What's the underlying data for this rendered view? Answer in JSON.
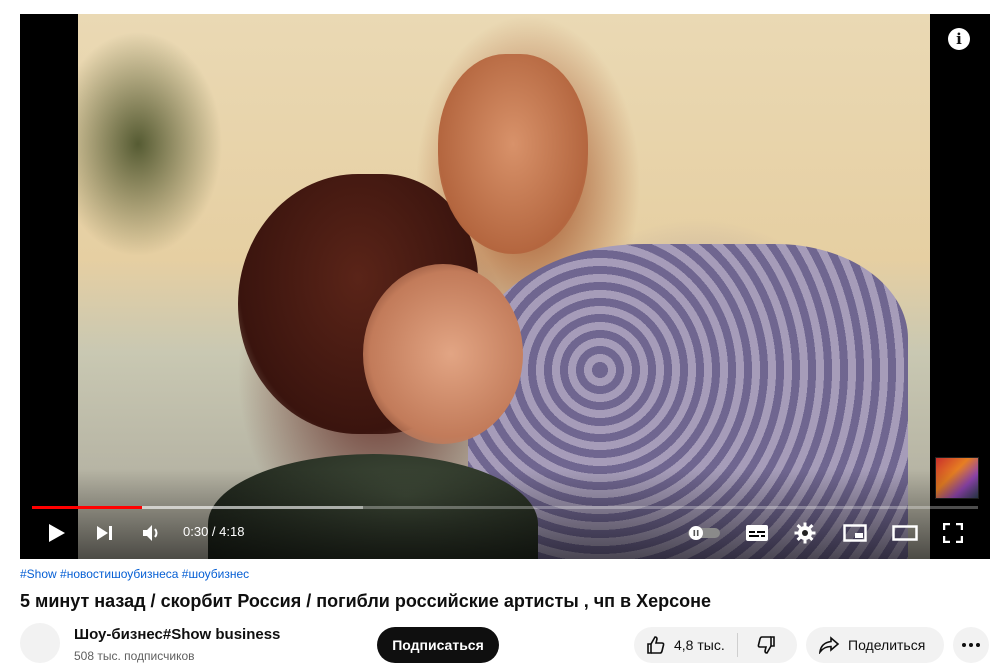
{
  "player": {
    "current_time": "0:30",
    "duration": "4:18",
    "time_display": "0:30 / 4:18",
    "progress_played": 0.116,
    "progress_buffered": 0.35,
    "icons": {
      "info": "info-icon",
      "play": "play-icon",
      "next": "next-icon",
      "volume": "volume-icon",
      "autoplay": "autoplay-toggle-icon",
      "subtitles": "subtitles-icon",
      "settings": "gear-icon",
      "miniplayer": "miniplayer-icon",
      "theater": "theater-mode-icon",
      "fullscreen": "fullscreen-icon"
    },
    "colors": {
      "progress": "#ff0000",
      "background": "#000000"
    }
  },
  "video": {
    "hashtags": "#Show #новостишоубизнеса #шоубизнес",
    "title": "5 минут назад / скорбит Россия / погибли российские артисты , чп в Херсоне"
  },
  "channel": {
    "name": "Шоу-бизнес#Show business",
    "subscribers": "508 тыс. подписчиков",
    "subscribe_label": "Подписаться"
  },
  "actions": {
    "likes": "4,8 тыс.",
    "share_label": "Поделиться",
    "icons": {
      "like": "thumbs-up-icon",
      "dislike": "thumbs-down-icon",
      "share": "share-arrow-icon",
      "more": "more-horizontal-icon"
    }
  },
  "colors": {
    "link": "#065fd4",
    "text": "#0f0f0f",
    "secondary_text": "#606060",
    "pill_bg": "#f2f2f2",
    "subscribe_bg": "#0f0f0f"
  }
}
